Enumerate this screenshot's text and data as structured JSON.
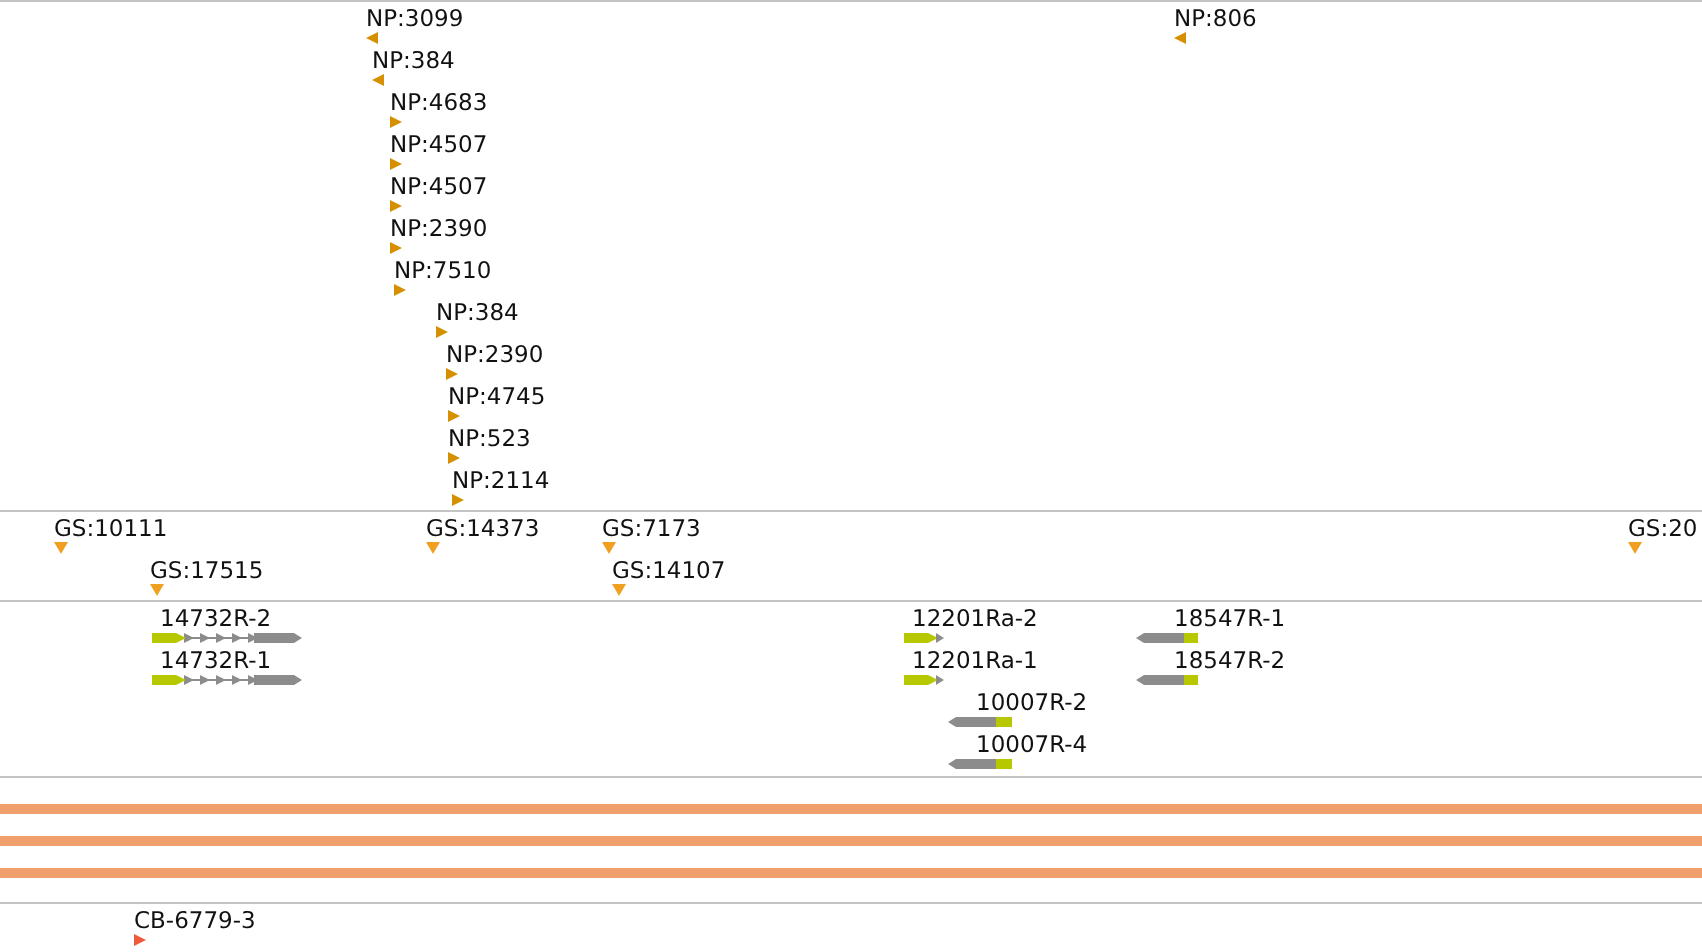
{
  "np_track": {
    "features": [
      {
        "label": "NP:3099",
        "kind": "reverse"
      },
      {
        "label": "NP:384",
        "kind": "reverse"
      },
      {
        "label": "NP:4683",
        "kind": "forward"
      },
      {
        "label": "NP:4507",
        "kind": "forward"
      },
      {
        "label": "NP:4507",
        "kind": "forward"
      },
      {
        "label": "NP:2390",
        "kind": "forward"
      },
      {
        "label": "NP:7510",
        "kind": "forward"
      },
      {
        "label": "NP:384",
        "kind": "forward"
      },
      {
        "label": "NP:2390",
        "kind": "forward"
      },
      {
        "label": "NP:4745",
        "kind": "forward"
      },
      {
        "label": "NP:523",
        "kind": "forward"
      },
      {
        "label": "NP:2114",
        "kind": "forward"
      },
      {
        "label": "NP:806",
        "kind": "reverse"
      }
    ]
  },
  "gs_track": {
    "features": [
      {
        "label": "GS:10111",
        "kind": "unstranded"
      },
      {
        "label": "GS:17515",
        "kind": "unstranded"
      },
      {
        "label": "GS:14373",
        "kind": "unstranded"
      },
      {
        "label": "GS:7173",
        "kind": "unstranded"
      },
      {
        "label": "GS:14107",
        "kind": "unstranded"
      },
      {
        "label": "GS:20",
        "kind": "unstranded"
      }
    ]
  },
  "gene_track": {
    "genes": [
      {
        "label": "14732R-2",
        "kind": "forward"
      },
      {
        "label": "14732R-1",
        "kind": "forward"
      },
      {
        "label": "12201Ra-2",
        "kind": "forward"
      },
      {
        "label": "12201Ra-1",
        "kind": "forward"
      },
      {
        "label": "10007R-2",
        "kind": "reverse"
      },
      {
        "label": "10007R-4",
        "kind": "reverse"
      },
      {
        "label": "18547R-1",
        "kind": "reverse"
      },
      {
        "label": "18547R-2",
        "kind": "reverse"
      }
    ]
  },
  "cb_track": {
    "features": [
      {
        "label": "CB-6779-3",
        "kind": "forward"
      }
    ]
  }
}
